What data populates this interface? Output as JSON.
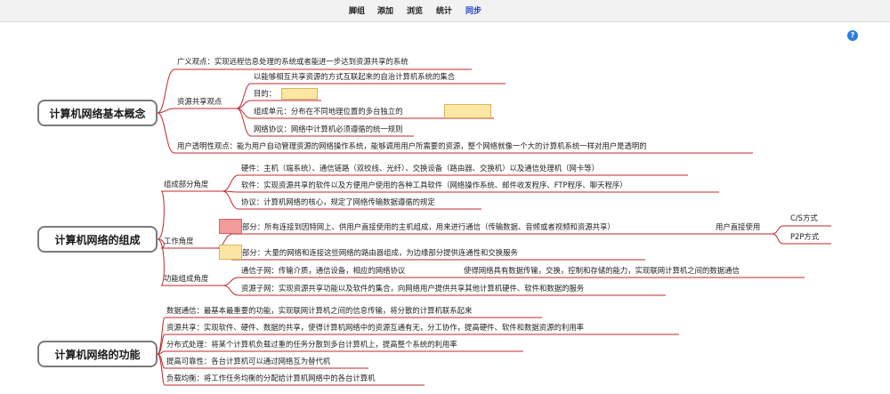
{
  "toolbar": {
    "items": [
      "脚组",
      "添加",
      "浏览",
      "统计",
      "同步"
    ],
    "active_index": 4,
    "active_color": "#1a3fcc"
  },
  "help_icon": {
    "glyph": "?",
    "icon": "help-icon",
    "color": "#2f7de1"
  },
  "mindmap": {
    "line_color": "#c2272d",
    "sections": [
      {
        "title": "计算机网络基本概念",
        "nodes": {
          "guangyi": "广义观点：实现远程信息处理的系统或者能进一步达到资源共享的系统",
          "ziyuan": "资源共享观点",
          "ziyuan_1": "以能够相互共享资源的方式互联起来的自治计算机系统的集合",
          "ziyuan_2": "目的：",
          "ziyuan_3": "组成单元：分布在不同地理位置的多台独立的",
          "ziyuan_4": "网络协议：网络中计算机必须遵循的统一规则",
          "yonghu": "用户透明性观点：能为用户自动管理资源的网络操作系统，能够调用用户所需要的资源，整个网络就像一个大的计算机系统一样对用户是透明的"
        }
      },
      {
        "title": "计算机网络的组成",
        "nodes": {
          "zucheng": "组成部分角度",
          "zucheng_1": "硬件：主机（端系统）、通信链路（双绞线、光纤）、交换设备（路由器、交换机）以及通信处理机（网卡等）",
          "zucheng_2": "软件：实现资源共享的软件以及方便用户使用的各种工具软件（网络操作系统、邮件收发程序、FTP程序、聊天程序）",
          "zucheng_3": "协议：计算机网络的核心，规定了网络传输数据遵循的规定",
          "gongzuo": "工作角度",
          "gongzuo_1": "部分：所有连接到因特网上、供用户直接使用的主机组成，用来进行通信（传输数据、音频或者视频和资源共享）",
          "gongzuo_1b": "用户直接使用",
          "gongzuo_1c1": "C/S方式",
          "gongzuo_1c2": "P2P方式",
          "gongzuo_2": "部分：大量的网络和连接这些网络的路由器组成，为边缘部分提供连通性和交换服务",
          "gongneng": "功能组成角度",
          "gongneng_1": "通信子网：传输介质，通信设备，相应的网络协议",
          "gongneng_1b": "使得网络具有数据传输，交换，控制和存储的能力，实现联网计算机之间的数据通信",
          "gongneng_2": "资源子网：实现资源共享功能以及软件的集合，向网络用户提供共享其他计算机硬件、软件和数据的服务"
        }
      },
      {
        "title": "计算机网络的功能",
        "nodes": {
          "f1": "数据通信：最基本最重要的功能，实现联网计算机之间的信息传输，将分散的计算机联系起来",
          "f2": "资源共享：实现软件、硬件、数据的共享，使得计算机网络中的资源互通有无，分工协作，提高硬件、软件和数据资源的利用率",
          "f3": "分布式处理：将某个计算机负载过重的任务分散到多台计算机上，提高整个系统的利用率",
          "f4": "提高可靠性：各台计算机可以通过网络互为替代机",
          "f5": "负载均衡：将工作任务均衡的分配给计算机网络中的各台计算机"
        }
      }
    ],
    "highlight_colors": {
      "yellow": "#fce6a3",
      "red": "#f39a9a"
    }
  }
}
